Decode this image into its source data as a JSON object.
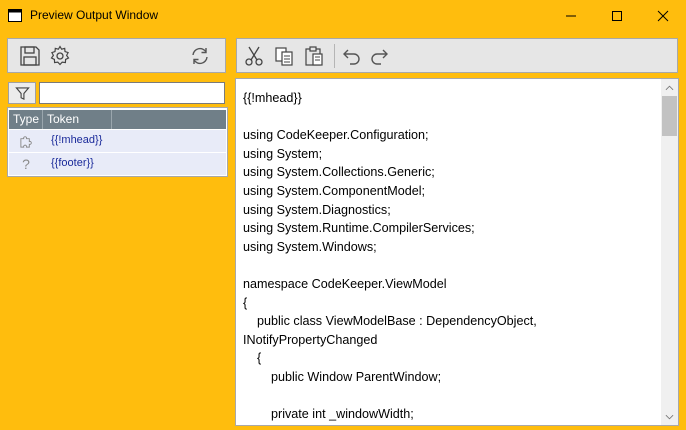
{
  "window": {
    "title": "Preview Output Window",
    "controls": [
      "minimize",
      "maximize",
      "close"
    ]
  },
  "left_toolbar": {
    "buttons": [
      {
        "icon": "save-icon",
        "label": "Save"
      },
      {
        "icon": "settings-icon",
        "label": "Settings"
      },
      {
        "icon": "refresh-icon",
        "label": "Refresh"
      }
    ]
  },
  "filter": {
    "icon": "filter-icon",
    "value": ""
  },
  "token_grid": {
    "columns": [
      "Type",
      "Token"
    ],
    "rows": [
      {
        "type_icon": "puzzle-icon",
        "token": "{{!mhead}}"
      },
      {
        "type_icon": "question-icon",
        "token": "{{footer}}"
      }
    ]
  },
  "editor_toolbar": {
    "buttons": [
      {
        "icon": "cut-icon",
        "label": "Cut"
      },
      {
        "icon": "copy-icon",
        "label": "Copy"
      },
      {
        "icon": "paste-icon",
        "label": "Paste"
      },
      {
        "icon": "undo-icon",
        "label": "Undo"
      },
      {
        "icon": "redo-icon",
        "label": "Redo"
      }
    ]
  },
  "editor": {
    "text": "{{!mhead}}\n\nusing CodeKeeper.Configuration;\nusing System;\nusing System.Collections.Generic;\nusing System.ComponentModel;\nusing System.Diagnostics;\nusing System.Runtime.CompilerServices;\nusing System.Windows;\n\nnamespace CodeKeeper.ViewModel\n{\n    public class ViewModelBase : DependencyObject, INotifyPropertyChanged\n    {\n        public Window ParentWindow;\n\n        private int _windowWidth;"
  },
  "colors": {
    "window_frame": "#ffbd0d",
    "grid_header": "#707f88",
    "grid_row": "#e8ebf8",
    "token_text": "#1a2a9a"
  }
}
